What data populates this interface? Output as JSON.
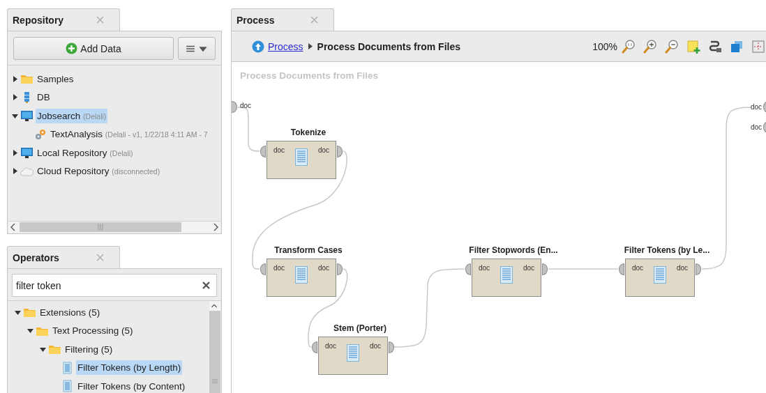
{
  "repository_panel": {
    "tab": {
      "label": "Repository"
    },
    "add_button": {
      "label": "Add Data"
    },
    "tree": [
      {
        "label": "Samples",
        "kind": "folder",
        "expanded": false,
        "selected": false
      },
      {
        "label": "DB",
        "kind": "database",
        "expanded": false,
        "selected": false
      },
      {
        "label": "Jobsearch",
        "detail": "(Delali)",
        "kind": "monitor",
        "expanded": true,
        "selected": true,
        "children": [
          {
            "label": "TextAnalysis",
            "detail": "(Delali - v1, 1/22/18 4:11 AM - 7",
            "kind": "process",
            "selected": false
          }
        ]
      },
      {
        "label": "Local Repository",
        "detail": "(Delali)",
        "kind": "monitor",
        "expanded": false,
        "selected": false
      },
      {
        "label": "Cloud Repository",
        "detail": "(disconnected)",
        "kind": "cloud",
        "expanded": false,
        "selected": false
      }
    ]
  },
  "operators_panel": {
    "tab": {
      "label": "Operators"
    },
    "search": {
      "value": "filter token"
    },
    "tree": [
      {
        "label": "Extensions (5)",
        "kind": "folder",
        "expanded": true,
        "selected": false,
        "children": [
          {
            "label": "Text Processing (5)",
            "kind": "folder",
            "expanded": true,
            "selected": false,
            "children": [
              {
                "label": "Filtering (5)",
                "kind": "folder",
                "expanded": true,
                "selected": false,
                "children": [
                  {
                    "label": "Filter Tokens (by Length)",
                    "kind": "operator",
                    "selected": true
                  },
                  {
                    "label": "Filter Tokens (by Content)",
                    "kind": "operator",
                    "selected": false
                  }
                ]
              }
            ]
          }
        ]
      }
    ]
  },
  "process_panel": {
    "tab": {
      "label": "Process"
    },
    "breadcrumb": [
      {
        "label": "Process",
        "kind": "link"
      },
      {
        "label": "Process Documents from Files",
        "kind": "current"
      }
    ],
    "zoom": "100%",
    "canvas_title": "Process Documents from Files",
    "source_ports": [
      "doc"
    ],
    "sink_ports": [
      "doc",
      "doc"
    ],
    "operators": [
      {
        "name": "Tokenize",
        "input": "doc",
        "output": "doc"
      },
      {
        "name": "Transform Cases",
        "input": "doc",
        "output": "doc"
      },
      {
        "name": "Stem (Porter)",
        "input": "doc",
        "output": "doc"
      },
      {
        "name": "Filter Stopwords (En...",
        "input": "doc",
        "output": "doc"
      },
      {
        "name": "Filter Tokens (by Le...",
        "input": "doc",
        "output": "doc"
      }
    ]
  }
}
